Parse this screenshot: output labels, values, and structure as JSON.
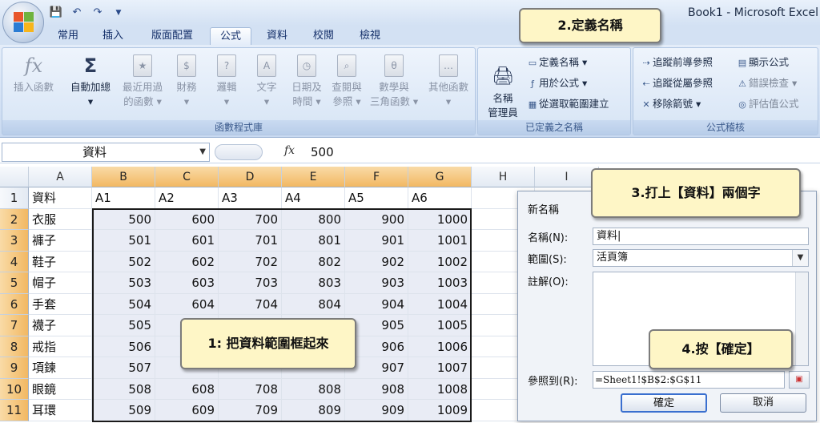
{
  "window_title": "Book1 - Microsoft Excel",
  "qat": {
    "save_icon": "save-icon",
    "undo_icon": "undo-icon",
    "redo_icon": "redo-icon"
  },
  "tabs": [
    "常用",
    "插入",
    "版面配置",
    "公式",
    "資料",
    "校閱",
    "檢視"
  ],
  "active_tab": "公式",
  "ribbon": {
    "function_library": {
      "label": "函數程式庫",
      "buttons": [
        {
          "line1": "插入函數",
          "line2": ""
        },
        {
          "line1": "自動加總",
          "line2": "▾"
        },
        {
          "line1": "最近用過",
          "line2": "的函數 ▾"
        },
        {
          "line1": "財務",
          "line2": "▾"
        },
        {
          "line1": "邏輯",
          "line2": "▾"
        },
        {
          "line1": "文字",
          "line2": "▾"
        },
        {
          "line1": "日期及",
          "line2": "時間 ▾"
        },
        {
          "line1": "查閱與",
          "line2": "參照 ▾"
        },
        {
          "line1": "數學與",
          "line2": "三角函數 ▾"
        },
        {
          "line1": "其他函數",
          "line2": "▾"
        }
      ]
    },
    "defined_names": {
      "label": "已定義之名稱",
      "name_manager_line1": "名稱",
      "name_manager_line2": "管理員",
      "define_name": "定義名稱 ▾",
      "use_in_formula": "用於公式 ▾",
      "create_from_selection": "從選取範圍建立"
    },
    "formula_auditing": {
      "label": "公式稽核",
      "trace_precedents": "追蹤前導參照",
      "trace_dependents": "追蹤從屬參照",
      "remove_arrows": "移除箭號 ▾",
      "show_formulas": "顯示公式",
      "error_checking": "錯誤檢查 ▾",
      "evaluate_formula": "評估值公式"
    }
  },
  "formula_bar": {
    "name_box": "資料",
    "fx": "fx",
    "value": "500"
  },
  "columns": [
    "A",
    "B",
    "C",
    "D",
    "E",
    "F",
    "G",
    "H",
    "I"
  ],
  "rows": [
    "1",
    "2",
    "3",
    "4",
    "5",
    "6",
    "7",
    "8",
    "9",
    "10",
    "11"
  ],
  "header_row": [
    "資料",
    "A1",
    "A2",
    "A3",
    "A4",
    "A5",
    "A6"
  ],
  "items": [
    "衣服",
    "褲子",
    "鞋子",
    "帽子",
    "手套",
    "襪子",
    "戒指",
    "項鍊",
    "眼鏡",
    "耳環"
  ],
  "values": [
    [
      "500",
      "600",
      "700",
      "800",
      "900",
      "1000"
    ],
    [
      "501",
      "601",
      "701",
      "801",
      "901",
      "1001"
    ],
    [
      "502",
      "602",
      "702",
      "802",
      "902",
      "1002"
    ],
    [
      "503",
      "603",
      "703",
      "803",
      "903",
      "1003"
    ],
    [
      "504",
      "604",
      "704",
      "804",
      "904",
      "1004"
    ],
    [
      "505",
      "",
      "",
      "",
      "905",
      "1005"
    ],
    [
      "506",
      "",
      "",
      "",
      "906",
      "1006"
    ],
    [
      "507",
      "",
      "",
      "",
      "907",
      "1007"
    ],
    [
      "508",
      "608",
      "708",
      "808",
      "908",
      "1008"
    ],
    [
      "509",
      "609",
      "709",
      "809",
      "909",
      "1009"
    ]
  ],
  "dialog": {
    "title": "新名稱",
    "name_label": "名稱(N):",
    "name_value": "資料|",
    "scope_label": "範圍(S):",
    "scope_value": "活頁簿",
    "comment_label": "註解(O):",
    "refers_label": "參照到(R):",
    "refers_value": "=Sheet1!$B$2:$G$11",
    "ok": "確定",
    "cancel": "取消"
  },
  "callouts": {
    "step1": "1: 把資料範圍框起來",
    "step2": "2.定義名稱",
    "step3": "3.打上【資料】兩個字",
    "step4": "4.按【確定】"
  }
}
